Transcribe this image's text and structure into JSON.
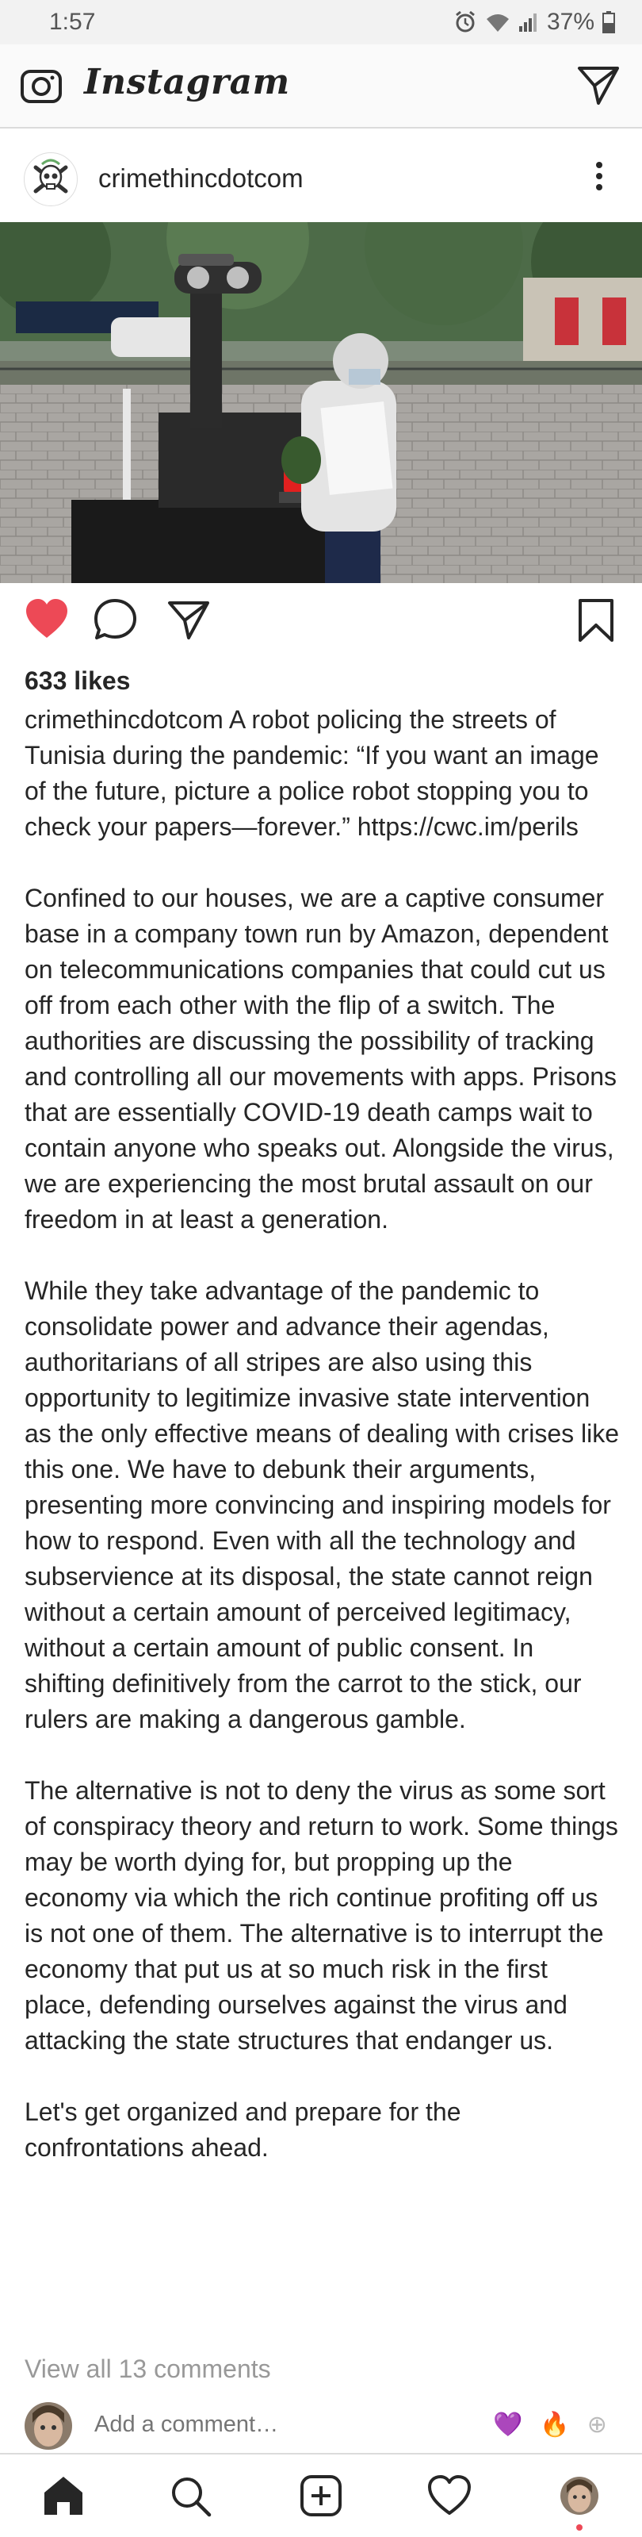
{
  "status_bar": {
    "time": "1:57",
    "battery": "37%",
    "icons": [
      "alarm-icon",
      "wifi-icon",
      "signal-icon",
      "battery-icon"
    ]
  },
  "app": {
    "brand": "Instagram",
    "icons": [
      "camera-icon",
      "direct-message-icon"
    ]
  },
  "post": {
    "username": "crimethincdotcom",
    "more_icon": "more-options-icon",
    "photo_description_icon": "post-photo",
    "actions": [
      "heart-icon",
      "comment-icon",
      "share-icon",
      "bookmark-icon"
    ],
    "liked": true,
    "likes": "633 likes",
    "caption_user": "crimethincdotcom",
    "paragraphs": [
      " A robot policing the streets of Tunisia during the pandemic: “If you want an image of the future, picture a police robot stopping you to check your papers—forever.” https://cwc.im/perils",
      "Confined to our houses, we are a captive consumer base in a company town run by Amazon, dependent on telecommunications companies that could cut us off from each other with the flip of a switch. The authorities are discussing the possibility of tracking and controlling all our movements with apps. Prisons that are essentially COVID-19 death camps wait to contain anyone who speaks out. Alongside the virus, we are experiencing the most brutal assault on our freedom in at least a generation.",
      "While they take advantage of the pandemic to consolidate power and advance their agendas, authoritarians of all stripes are also using this opportunity to legitimize invasive state intervention as the only effective means of dealing with crises like this one. We have to debunk their arguments, presenting more convincing and inspiring models for how to respond. Even with all the technology and subservience at its disposal, the state cannot reign without a certain amount of perceived legitimacy, without a certain amount of public consent. In shifting definitively from the carrot to the stick, our rulers are making a dangerous gamble.",
      "The alternative is not to deny the virus as some sort of conspiracy theory and return to work. Some things may be worth dying for, but propping up the economy via which the rich continue profiting off us is not one of them. The alternative is to interrupt the economy that put us at so much risk in the first place, defending ourselves against the virus and attacking the state structures that endanger us.",
      "Let's get organized and prepare for the confrontations ahead."
    ],
    "view_comments": "View all 13 comments",
    "comment_placeholder": "Add a comment…",
    "reactions": [
      "💜",
      "🔥",
      "⊕"
    ]
  },
  "bottom_nav": {
    "items": [
      "home-icon",
      "search-icon",
      "new-post-icon",
      "activity-icon",
      "profile-avatar"
    ]
  },
  "colors": {
    "heart_red": "#ed4956",
    "text": "#262626",
    "muted": "#999999",
    "border": "#dbdbdb"
  }
}
